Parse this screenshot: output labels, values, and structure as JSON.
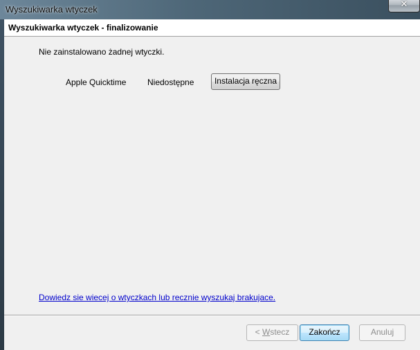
{
  "window": {
    "title": "Wyszukiwarka wtyczek",
    "close_symbol": "✕"
  },
  "wizard": {
    "page_title": "Wyszukiwarka wtyczek - finalizowanie",
    "status_message": "Nie zainstalowano żadnej wtyczki.",
    "plugins": [
      {
        "name": "Apple Quicktime",
        "status": "Niedostępne",
        "action_label": "Instalacja ręczna"
      }
    ],
    "more_info_link": "Dowiedz sie wiecej o wtyczkach lub recznie wyszukaj brakujace."
  },
  "footer": {
    "back_prefix": "< ",
    "back_accesskey": "W",
    "back_rest": "stecz",
    "back_disabled": true,
    "finish_label": "Zakończ",
    "cancel_label": "Anuluj",
    "cancel_disabled": true
  },
  "icons": {
    "close": "close-icon"
  }
}
